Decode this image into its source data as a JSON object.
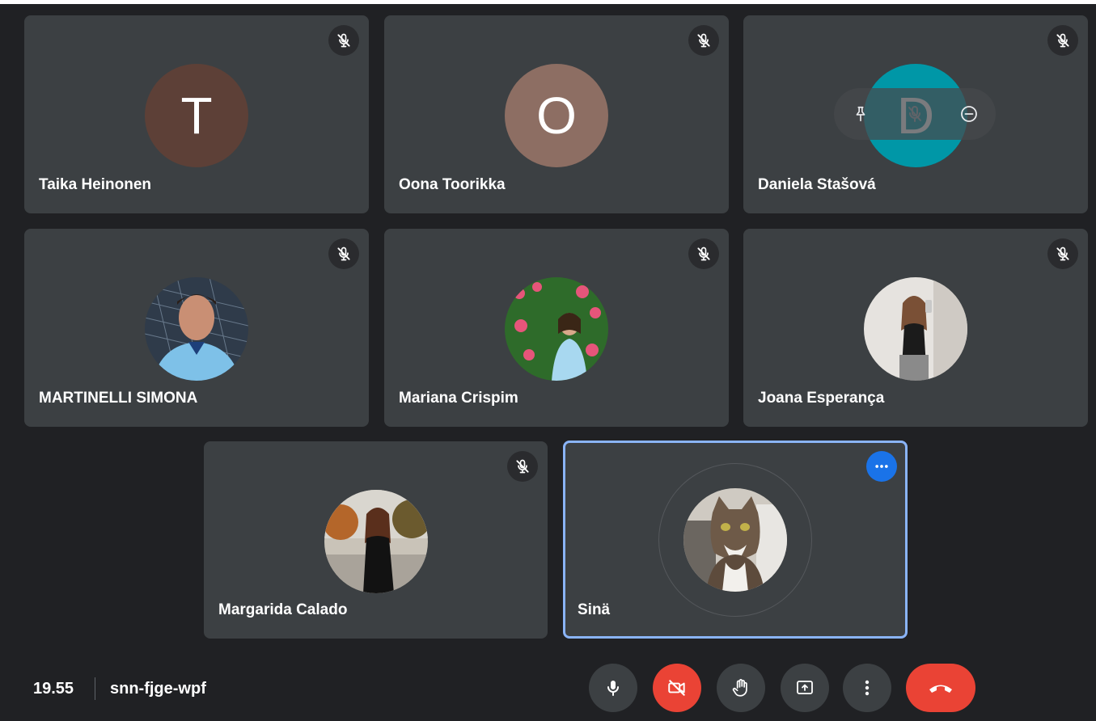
{
  "participants": [
    {
      "name": "Taika Heinonen",
      "initial": "T",
      "avatar_color": "#5d4037"
    },
    {
      "name": "Oona Toorikka",
      "initial": "O",
      "avatar_color": "#8d6e63"
    },
    {
      "name": "Daniela Stašová",
      "initial": "D",
      "avatar_color": "#0097a7"
    },
    {
      "name": "MARTINELLI SIMONA"
    },
    {
      "name": "Mariana Crispim"
    },
    {
      "name": "Joana Esperança"
    },
    {
      "name": "Margarida Calado"
    },
    {
      "name": "Sinä"
    }
  ],
  "meeting": {
    "time": "19.55",
    "code": "snn-fjge-wpf"
  },
  "icons": {
    "mute": "mic-off-icon",
    "pin": "pin-icon",
    "remove": "remove-icon",
    "more": "more-horizontal-icon",
    "mic": "mic-icon",
    "camera_off": "camera-off-icon",
    "raise_hand": "raise-hand-icon",
    "present": "present-screen-icon",
    "more_vert": "more-vertical-icon",
    "hangup": "hangup-icon"
  },
  "colors": {
    "self_border": "#8ab4f8",
    "accent": "#1a73e8",
    "danger": "#ea4335",
    "tile": "#3c4043",
    "bg": "#202124"
  }
}
